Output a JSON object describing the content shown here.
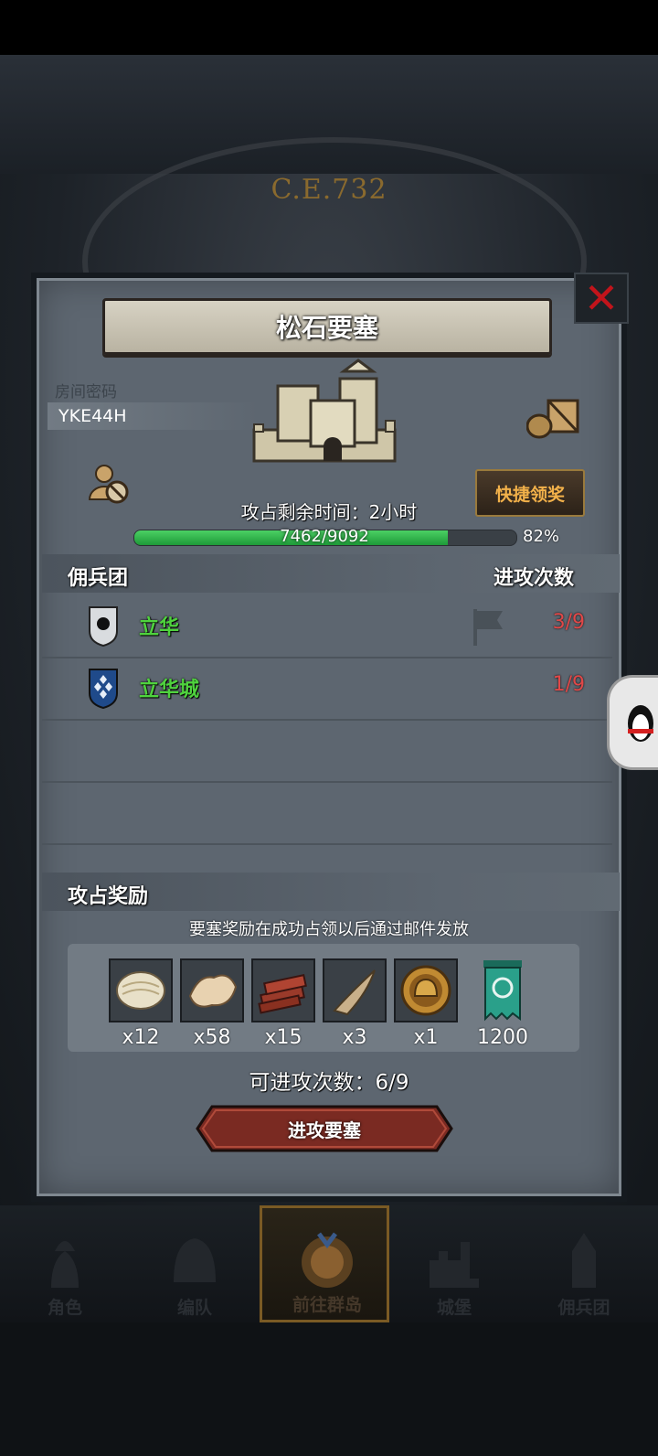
{
  "background": {
    "era": "C.E.732"
  },
  "dialog": {
    "title": "松石要塞",
    "room_label": "房间密码",
    "room_code": "YKE44H",
    "claim_button": "快捷领奖",
    "time_label": "攻占剩余时间：2小时",
    "progress": {
      "current": 7462,
      "max": 9092,
      "text": "7462/9092",
      "percent_text": "82%",
      "fraction": 0.82
    },
    "mercenary_header": "佣兵团",
    "attack_header": "进攻次数",
    "guilds": [
      {
        "name": "立华",
        "attacks": "3/9",
        "shield": "sun-shield-icon"
      },
      {
        "name": "立华城",
        "attacks": "1/9",
        "shield": "diamond-shield-icon"
      }
    ],
    "reward_header": "攻占奖励",
    "reward_note": "要塞奖励在成功占领以后通过邮件发放",
    "rewards": [
      {
        "icon": "fleece-icon",
        "qty": "x12"
      },
      {
        "icon": "fur-icon",
        "qty": "x58"
      },
      {
        "icon": "lumber-icon",
        "qty": "x15"
      },
      {
        "icon": "horn-icon",
        "qty": "x3"
      },
      {
        "icon": "helmet-coin-icon",
        "qty": "x1"
      },
      {
        "icon": "banner-icon",
        "qty": "1200"
      }
    ],
    "attacks_left": "可进攻次数：6/9",
    "attack_button": "进攻要塞"
  },
  "nav": [
    {
      "label": "角色",
      "active": false
    },
    {
      "label": "编队",
      "active": false
    },
    {
      "label": "前往群岛",
      "active": true
    },
    {
      "label": "城堡",
      "active": false
    },
    {
      "label": "佣兵团",
      "active": false
    }
  ],
  "colors": {
    "progress": "#2fb24a",
    "guild_name": "#4fd23e",
    "attack_count": "#e04848",
    "claim_text": "#f2b14a",
    "close": "#c2141b"
  }
}
